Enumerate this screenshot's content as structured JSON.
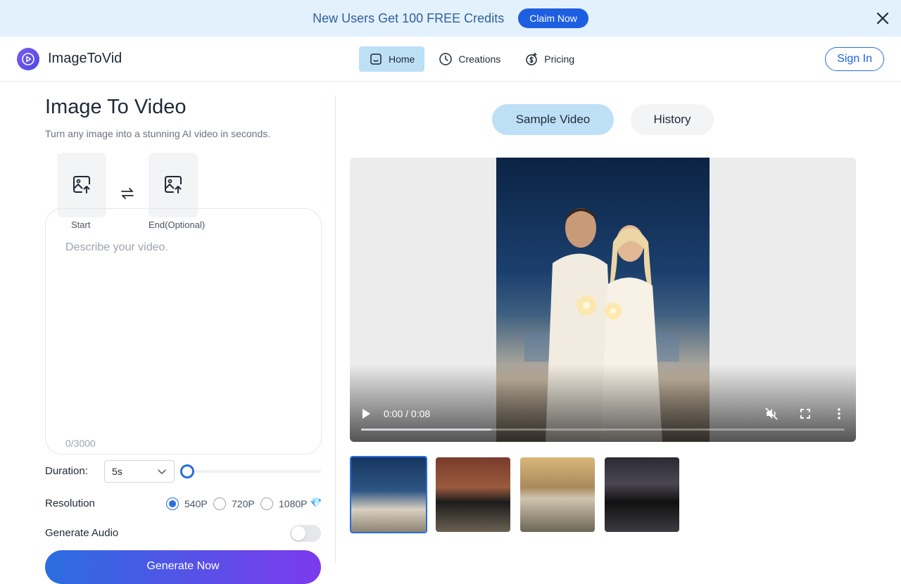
{
  "banner": {
    "text": "New Users Get 100 FREE Credits",
    "cta": "Claim Now",
    "close_icon": "close-icon"
  },
  "header": {
    "brand": "ImageToVid",
    "nav": [
      {
        "label": "Home",
        "icon": "home-icon",
        "active": true
      },
      {
        "label": "Creations",
        "icon": "clock-icon",
        "active": false
      },
      {
        "label": "Pricing",
        "icon": "dollar-icon",
        "active": false
      }
    ],
    "sign_in": "Sign In"
  },
  "left": {
    "title": "Image To Video",
    "subtitle": "Turn any image into a stunning AI video in seconds.",
    "upload_start": "Start",
    "upload_end": "End(Optional)",
    "prompt_placeholder": "Describe your video.",
    "counter": "0/3000",
    "duration_label": "Duration:",
    "duration_value": "5s",
    "duration_slider_fraction": 0,
    "resolution_label": "Resolution",
    "resolutions": [
      {
        "label": "540P",
        "checked": true
      },
      {
        "label": "720P",
        "checked": false
      },
      {
        "label": "1080P",
        "checked": false,
        "badge": "💎"
      }
    ],
    "audio_label": "Generate Audio",
    "audio_enabled": false,
    "generate_label": "Generate Now"
  },
  "right": {
    "tabs": [
      {
        "label": "Sample Video",
        "active": true
      },
      {
        "label": "History",
        "active": false
      }
    ],
    "video": {
      "time": "0:00 / 0:08",
      "progress_fraction": 0.27
    },
    "thumbnails": [
      {
        "name": "couple-beach",
        "selected": true
      },
      {
        "name": "graduate",
        "selected": false
      },
      {
        "name": "hooded-girl",
        "selected": false
      },
      {
        "name": "black-dress",
        "selected": false
      }
    ]
  },
  "colors": {
    "accent": "#2b6de0",
    "banner_bg": "#e3f1fc",
    "active_tab": "#bde0f7"
  }
}
